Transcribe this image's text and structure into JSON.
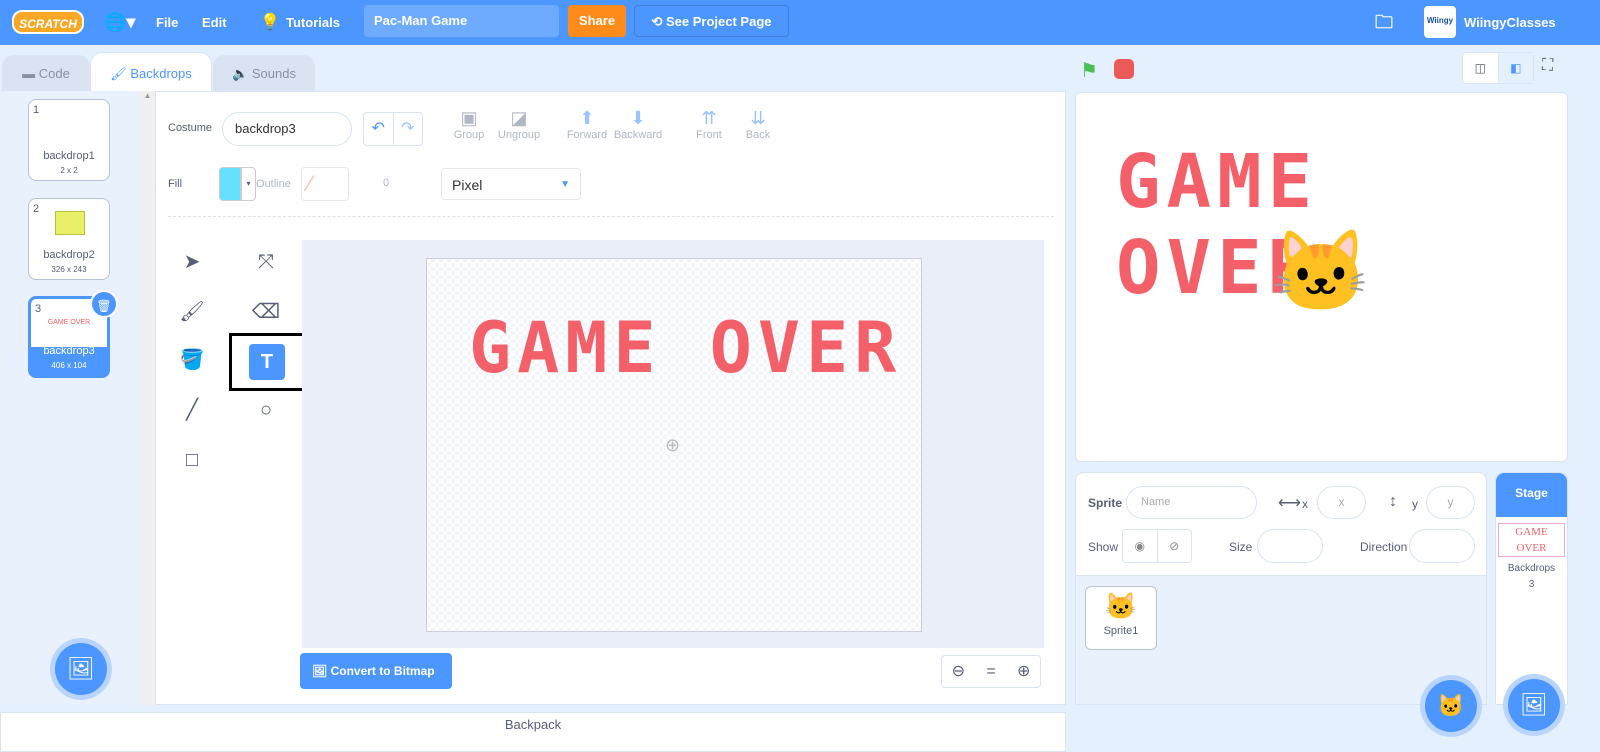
{
  "menubar": {
    "logo": "SCRATCH",
    "file": "File",
    "edit": "Edit",
    "tutorials": "Tutorials",
    "project_title": "Pac-Man Game",
    "share": "Share",
    "see_project": "See Project Page",
    "username": "WiingyClasses",
    "accent": "#4c97ff"
  },
  "tabs": [
    {
      "label": "Code"
    },
    {
      "label": "Backdrops"
    },
    {
      "label": "Sounds"
    }
  ],
  "backdrops": [
    {
      "num": "1",
      "name": "backdrop1",
      "size": "2 x 2"
    },
    {
      "num": "2",
      "name": "backdrop2",
      "size": "326 x 243"
    },
    {
      "num": "3",
      "name": "backdrop3",
      "size": "406 x 104",
      "thumb_text": "GAME OVER"
    }
  ],
  "editor": {
    "costume_label": "Costume",
    "costume_name": "backdrop3",
    "group": "Group",
    "ungroup": "Ungroup",
    "forward": "Forward",
    "backward": "Backward",
    "front": "Front",
    "back": "Back",
    "fill_label": "Fill",
    "fill_color": "#66e0ff",
    "outline_label": "Outline",
    "outline_width": "0",
    "font": "Pixel",
    "canvas_text": "GAME OVER",
    "convert": "Convert to Bitmap",
    "zoom_reset": "="
  },
  "stage": {
    "text": "GAME OVER"
  },
  "sprite_info": {
    "sprite_label": "Sprite",
    "name_placeholder": "Name",
    "x_label": "x",
    "x_placeholder": "x",
    "y_label": "y",
    "y_placeholder": "y",
    "show_label": "Show",
    "size_label": "Size",
    "direction_label": "Direction"
  },
  "sprites": [
    {
      "name": "Sprite1"
    }
  ],
  "stage_panel": {
    "header": "Stage",
    "thumb_text": "GAME OVER",
    "backdrops_label": "Backdrops",
    "backdrops_count": "3"
  },
  "backpack": "Backpack"
}
